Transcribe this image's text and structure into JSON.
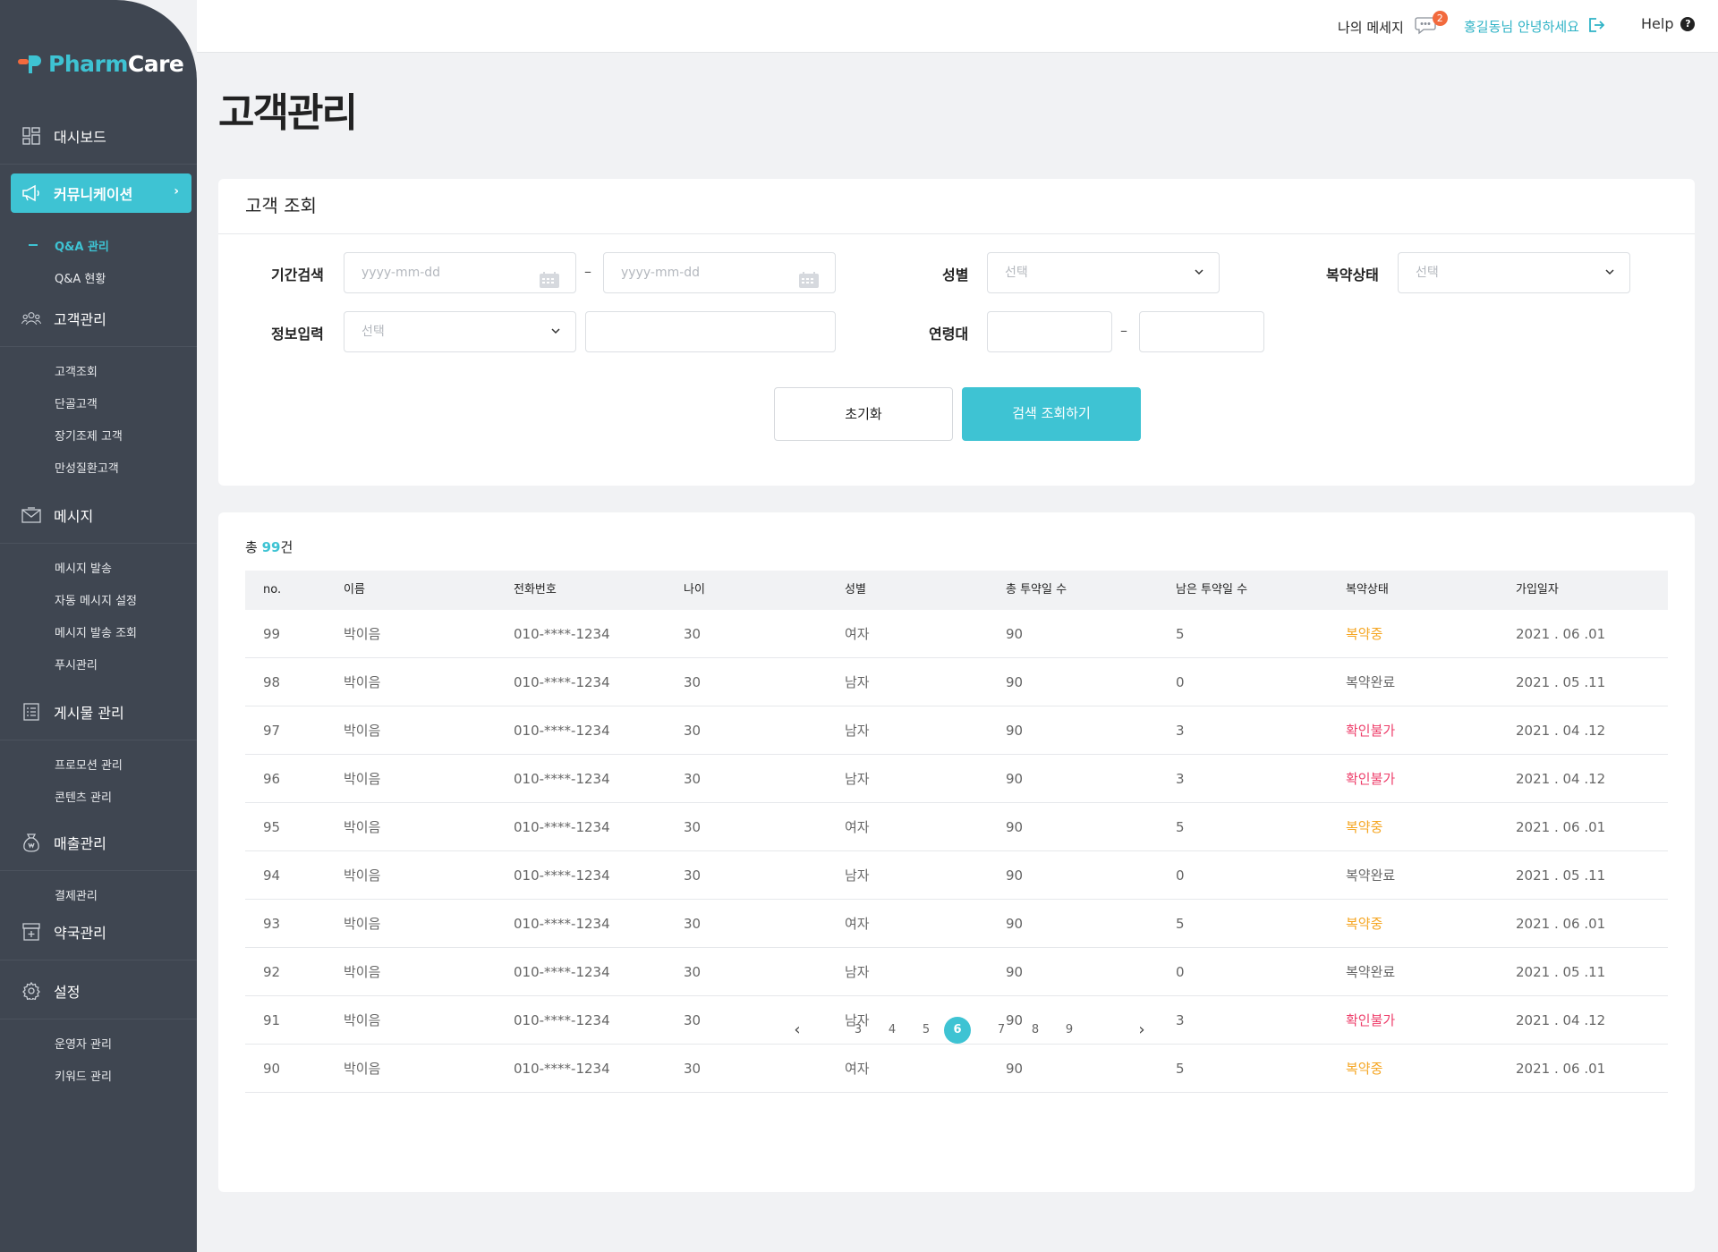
{
  "brand": {
    "name_a": "Pharm",
    "name_b": "Care"
  },
  "sidebar": {
    "groups": [
      {
        "label": "대시보드",
        "items": []
      },
      {
        "label": "커뮤니케이션",
        "items": [
          "Q&A 관리",
          "Q&A 현황"
        ]
      },
      {
        "label": "고객관리",
        "items": [
          "고객조회",
          "단골고객",
          "장기조제 고객",
          "만성질환고객"
        ]
      },
      {
        "label": "메시지",
        "items": [
          "메시지 발송",
          "자동 메시지 설정",
          "메시지 발송 조회",
          "푸시관리"
        ]
      },
      {
        "label": "게시물 관리",
        "items": [
          "프로모션 관리",
          "콘텐츠 관리"
        ]
      },
      {
        "label": "매출관리",
        "items": [
          "결제관리"
        ]
      },
      {
        "label": "약국관리",
        "items": []
      },
      {
        "label": "설정",
        "items": [
          "운영자 관리",
          "키워드 관리"
        ]
      }
    ]
  },
  "topbar": {
    "messages_label": "나의 메세지",
    "messages_count": "2",
    "greeting": "홍길동님 안녕하세요",
    "help_label": "Help",
    "help_icon": "?"
  },
  "page_title": "고객관리",
  "search": {
    "title": "고객 조회",
    "period_label": "기간검색",
    "date_placeholder": "yyyy-mm-dd",
    "gender_label": "성별",
    "gender_value": "선택",
    "status_label": "복약상태",
    "status_value": "선택",
    "info_label": "정보입력",
    "info_value": "선택",
    "age_label": "연령대",
    "dash": "–",
    "reset_label": "초기화",
    "submit_label": "검색 조회하기"
  },
  "table": {
    "total_prefix": "총 ",
    "total_count": "99",
    "total_suffix": "건",
    "columns": [
      "no.",
      "이름",
      "전화번호",
      "나이",
      "성별",
      "총 투약일 수",
      "남은 투약일 수",
      "복약상태",
      "가입일자"
    ],
    "rows": [
      [
        "99",
        "박이음",
        "010-****-1234",
        "30",
        "여자",
        "90",
        "5",
        "복약중",
        "2021 . 06 .01"
      ],
      [
        "98",
        "박이음",
        "010-****-1234",
        "30",
        "남자",
        "90",
        "0",
        "복약완료",
        "2021 . 05 .11"
      ],
      [
        "97",
        "박이음",
        "010-****-1234",
        "30",
        "남자",
        "90",
        "3",
        "확인불가",
        "2021 . 04 .12"
      ],
      [
        "96",
        "박이음",
        "010-****-1234",
        "30",
        "남자",
        "90",
        "3",
        "확인불가",
        "2021 . 04 .12"
      ],
      [
        "95",
        "박이음",
        "010-****-1234",
        "30",
        "여자",
        "90",
        "5",
        "복약중",
        "2021 . 06 .01"
      ],
      [
        "94",
        "박이음",
        "010-****-1234",
        "30",
        "남자",
        "90",
        "0",
        "복약완료",
        "2021 . 05 .11"
      ],
      [
        "93",
        "박이음",
        "010-****-1234",
        "30",
        "여자",
        "90",
        "5",
        "복약중",
        "2021 . 06 .01"
      ],
      [
        "92",
        "박이음",
        "010-****-1234",
        "30",
        "남자",
        "90",
        "0",
        "복약완료",
        "2021 . 05 .11"
      ],
      [
        "91",
        "박이음",
        "010-****-1234",
        "30",
        "남자",
        "90",
        "3",
        "확인불가",
        "2021 . 04 .12"
      ],
      [
        "90",
        "박이음",
        "010-****-1234",
        "30",
        "여자",
        "90",
        "5",
        "복약중",
        "2021 . 06 .01"
      ]
    ]
  },
  "pagination": {
    "prev": "‹",
    "next": "›",
    "pages": [
      "3",
      "4",
      "5",
      "6",
      "7",
      "8",
      "9"
    ],
    "current": "6"
  },
  "colors": {
    "accent": "#3ec3d3",
    "sidebar": "#3f4651",
    "status_on": "#f5a623",
    "status_err": "#ee3f6b",
    "badge": "#f26a3d"
  }
}
